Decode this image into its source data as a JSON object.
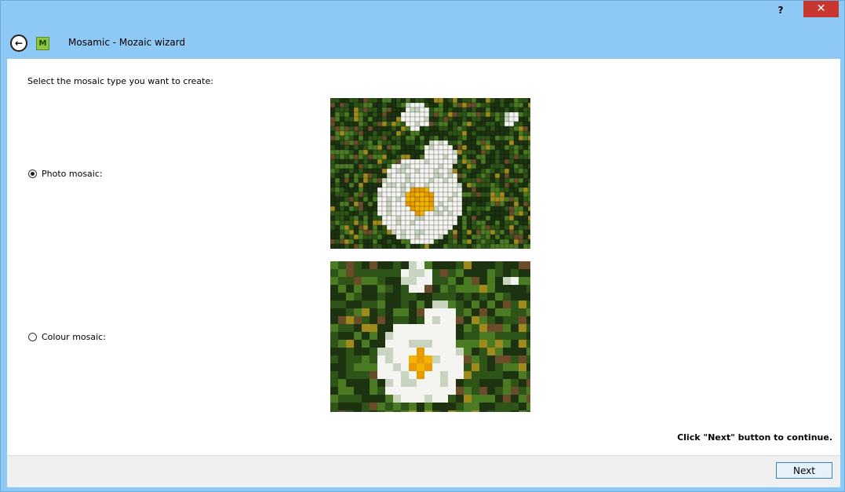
{
  "window": {
    "title": "Mosamic - Mozaic wizard",
    "help_label": "?",
    "close_label": "✕"
  },
  "header": {
    "logo_letter": "M"
  },
  "main": {
    "prompt": "Select the mosaic type you want to create:",
    "options": [
      {
        "label": "Photo mosaic:",
        "selected": true
      },
      {
        "label": "Colour mosaic:",
        "selected": false
      }
    ],
    "hint": "Click \"Next\" button to continue."
  },
  "footer": {
    "next_label": "Next"
  },
  "colors": {
    "titlebar": "#8ec8f4",
    "close": "#c7372f",
    "leaf_dark": "#1f3a12",
    "leaf_mid": "#3f6f1e",
    "petal": "#f6f6f6",
    "center": "#f2b400"
  }
}
